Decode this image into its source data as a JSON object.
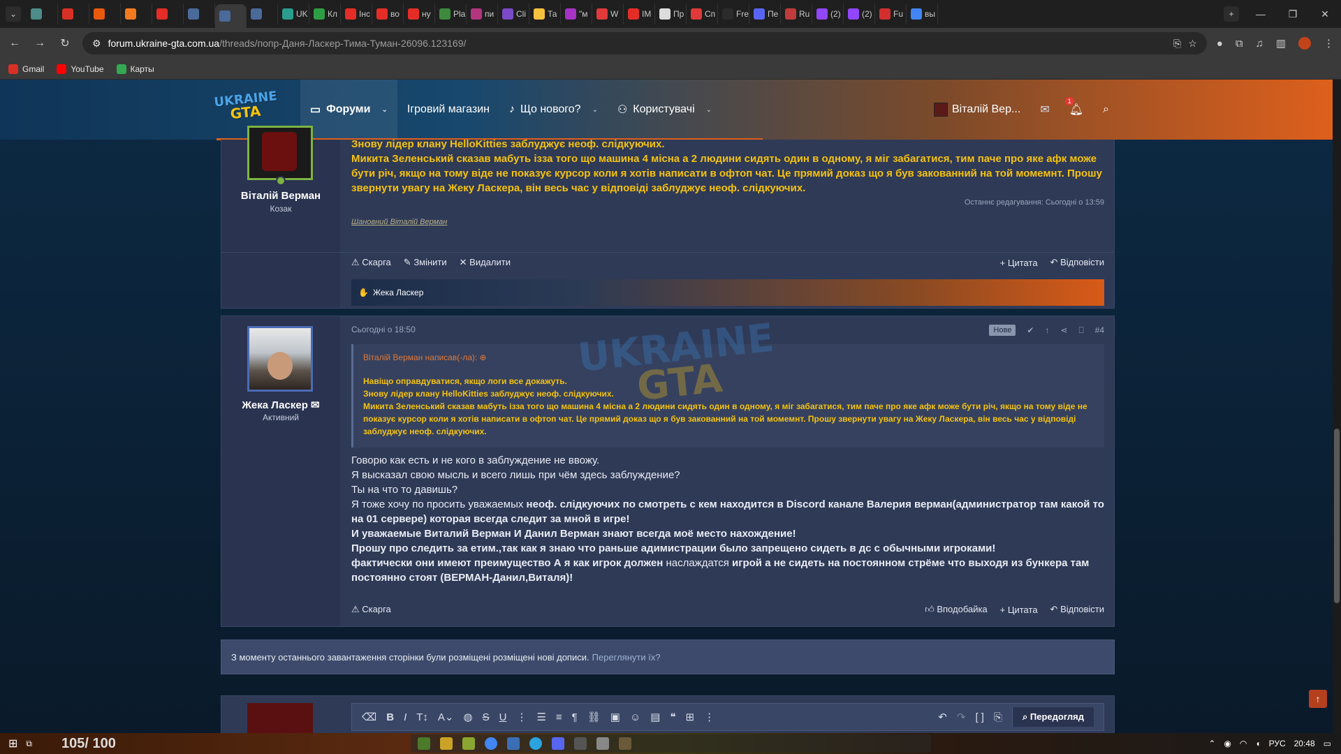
{
  "browser": {
    "tabs": [
      {
        "label": "",
        "color": "#4c8c8a"
      },
      {
        "label": "",
        "color": "#d93025"
      },
      {
        "label": "",
        "color": "#e8590c"
      },
      {
        "label": "",
        "color": "#f47a20"
      },
      {
        "label": "",
        "color": "#e52d27"
      },
      {
        "label": "",
        "color": "#4a6a9a"
      },
      {
        "label": "",
        "color": "#4a6a9a",
        "active": true
      },
      {
        "label": "",
        "color": "#4a6a9a"
      },
      {
        "label": "UK",
        "color": "#2a9d8f"
      },
      {
        "label": "Кл",
        "color": "#2e9e44"
      },
      {
        "label": "Інс",
        "color": "#e52d27"
      },
      {
        "label": "во",
        "color": "#e52d27"
      },
      {
        "label": "ну",
        "color": "#e52d27"
      },
      {
        "label": "Pla",
        "color": "#3d8a3d"
      },
      {
        "label": "пи",
        "color": "#b3367f"
      },
      {
        "label": "Cli",
        "color": "#7a4ac7"
      },
      {
        "label": "Та",
        "color": "#f6c23e"
      },
      {
        "label": "\"м",
        "color": "#a633c4"
      },
      {
        "label": "W",
        "color": "#e03a3a"
      },
      {
        "label": "IM",
        "color": "#e52d27"
      },
      {
        "label": "Пр",
        "color": "#dcdcdc"
      },
      {
        "label": "Сп",
        "color": "#e03a3a"
      },
      {
        "label": "Fre",
        "color": "#2b2b2b"
      },
      {
        "label": "Пе",
        "color": "#5865f2"
      },
      {
        "label": "Ru",
        "color": "#c23b3b"
      },
      {
        "label": "(2)",
        "color": "#9146ff"
      },
      {
        "label": "(2)",
        "color": "#9146ff"
      },
      {
        "label": "Fu",
        "color": "#d32f2f"
      },
      {
        "label": "вы",
        "color": "#4285f4"
      }
    ],
    "new_tab": "+",
    "window_controls": {
      "minimize": "—",
      "restore": "❐",
      "close": "✕"
    },
    "url_host": "forum.ukraine-gta.com.ua",
    "url_path": "/threads/попр-Даня-Ласкер-Тима-Туман-26096.123169/",
    "bookmarks": [
      {
        "label": "Gmail",
        "color": "#d93025"
      },
      {
        "label": "YouTube",
        "color": "#ff0000"
      },
      {
        "label": "Карты",
        "color": "#34a853"
      }
    ]
  },
  "site": {
    "logo_top": "UKRAINE",
    "logo_bottom": "GTA",
    "nav": [
      {
        "label": "Форуми",
        "icon": "chat-icon",
        "selected": true,
        "caret": true
      },
      {
        "label": "Ігровий магазин",
        "icon": "",
        "selected": false,
        "caret": false
      },
      {
        "label": "Що нового?",
        "icon": "bell-icon",
        "selected": false,
        "caret": true
      },
      {
        "label": "Користувачі",
        "icon": "users-icon",
        "selected": false,
        "caret": true
      }
    ],
    "user_name": "Віталій Вер...",
    "alerts_count": "1"
  },
  "post1": {
    "author": "Віталій Верман",
    "author_title": "Козак",
    "lines": [
      "Знову лідер клану HelloKitties заблуджує неоф. слідкуючих.",
      "Микита Зеленський сказав мабуть ізза того що машина 4 місна а 2 людини сидять один в одному, я міг забагатися, тим паче про яке афк може бути річ, якщо на тому віде не показує курсор коли я хотів написати в офтоп чат. Це прямий доказ що я був закованний на той момемнт. Прошу звернути увагу на Жеку Ласкера, він весь час у відповіді заблуджує неоф. слідкуючих."
    ],
    "edited": "Останнє редагування: Сьогодні о 13:59",
    "signature": "Шановний Віталій Верман",
    "actions_left": [
      "Скарга",
      "Змінити",
      "Видалити"
    ],
    "actions_right": [
      "Цитата",
      "Відповісти"
    ],
    "reaction_user": "Жека Ласкер"
  },
  "post2": {
    "author": "Жека Ласкер",
    "author_title": "Активний",
    "date": "Сьогодні о 18:50",
    "new_label": "Нове",
    "number": "#4",
    "quote_head": "Віталій Верман написав(-ла):",
    "quote_lines": [
      "Навіщо оправдуватися, якщо логи все докажуть.",
      "Знову лідер клану HelloKitties заблуджує неоф. слідкуючих.",
      "Микита Зеленський сказав мабуть ізза того що машина 4 місна а 2 людини сидять один в одному, я міг забагатися, тим паче про яке афк може бути річ, якщо на тому віде не показує курсор коли я хотів написати в офтоп чат. Це прямий доказ що я був закованний на той момемнт. Прошу звернути увагу на Жеку Ласкера, він весь час у відповіді заблуджує неоф. слідкуючих."
    ],
    "msg_plain": [
      "Говорю как есть и не кого в заблуждение не ввожу.",
      "Я высказал свою мысль и всего лишь при чём здесь заблуждение?",
      "Ты на что то давишь?"
    ],
    "msg_rich_1a": "Я тоже хочу по просить уважаемых ",
    "msg_rich_1b": "неоф. слідкуючих по смотреть с кем находится в Discord канале Валерия верман(администратор там какой то на 01 сервере) которая всегда следит за мной в игре!",
    "msg_bold_2": "И уважаемые Виталий Верман И Данил Верман знают всегда моё место нахождение!",
    "msg_bold_3": "Прошу про следить за етим.,так как я знаю что раньше адимистрации было запрещено сидеть в дс с обычными игроками!",
    "msg_rich_4a": "фактически они имеют преимущество А я как игрок должен ",
    "msg_rich_4b": "наслаждатся",
    "msg_rich_4c": " игрой а не сидеть на постоянном стрёме что выходя из бункера там постоянно стоят (ВЕРМАН-Данил,Виталя)!",
    "actions_left": [
      "Скарга"
    ],
    "actions_right": [
      "Вподобайка",
      "Цитата",
      "Відповісти"
    ]
  },
  "notice": {
    "text": "З моменту останнього завантаження сторінки були розміщені розміщені нові дописи.",
    "link": "Переглянути їх?"
  },
  "editor": {
    "preview_label": "Передогляд"
  },
  "taskbar": {
    "counter": "105/ 100",
    "lang": "РУС",
    "time": "20:48"
  }
}
